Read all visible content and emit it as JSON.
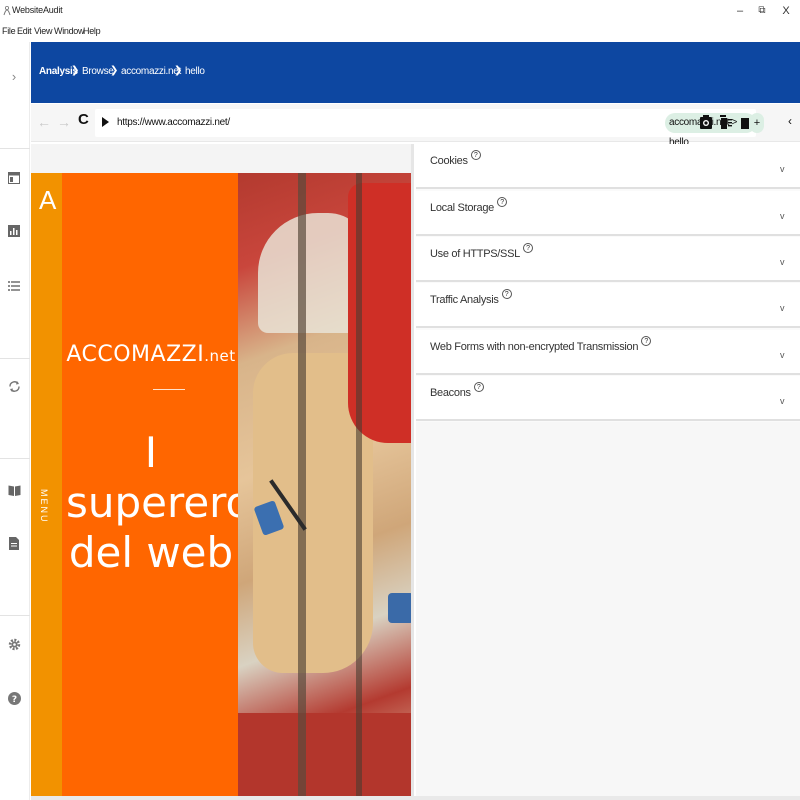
{
  "window": {
    "title": "WebsiteAudit",
    "minimize": "–",
    "maximize": "⧉",
    "close": "X"
  },
  "menu": [
    "File",
    "Edit",
    "View",
    "Window",
    "Help"
  ],
  "sidebar": {
    "expand_glyph": "›"
  },
  "breadcrumb": {
    "items": [
      "Analysis",
      "Browse",
      "accomazzi.net",
      "hello"
    ],
    "separator": "❯"
  },
  "addressbar": {
    "back": "←",
    "forward": "→",
    "reload": "C",
    "url": "https://www.accomazzi.net/",
    "site_chip": "accomazzi.net > hello",
    "chip_add": "+",
    "collapse": "‹"
  },
  "preview": {
    "logo_letter": "A",
    "menu_label": "MENU",
    "brand_main": "ACCOMAZZI",
    "brand_suffix": ".net",
    "hero_lines": [
      "I",
      "supereroi",
      "del web"
    ]
  },
  "panel": {
    "help_glyph": "?",
    "chevron": "v",
    "sections": [
      {
        "title": "Cookies"
      },
      {
        "title": "Local Storage"
      },
      {
        "title": "Use of HTTPS/SSL"
      },
      {
        "title": "Traffic Analysis"
      },
      {
        "title": "Web Forms with non-encrypted Transmission"
      },
      {
        "title": "Beacons"
      }
    ]
  },
  "colors": {
    "header_blue": "#0d47a1",
    "orange": "#ff6600",
    "orange_strip": "#f29200",
    "chip_green": "#dcefe4"
  }
}
